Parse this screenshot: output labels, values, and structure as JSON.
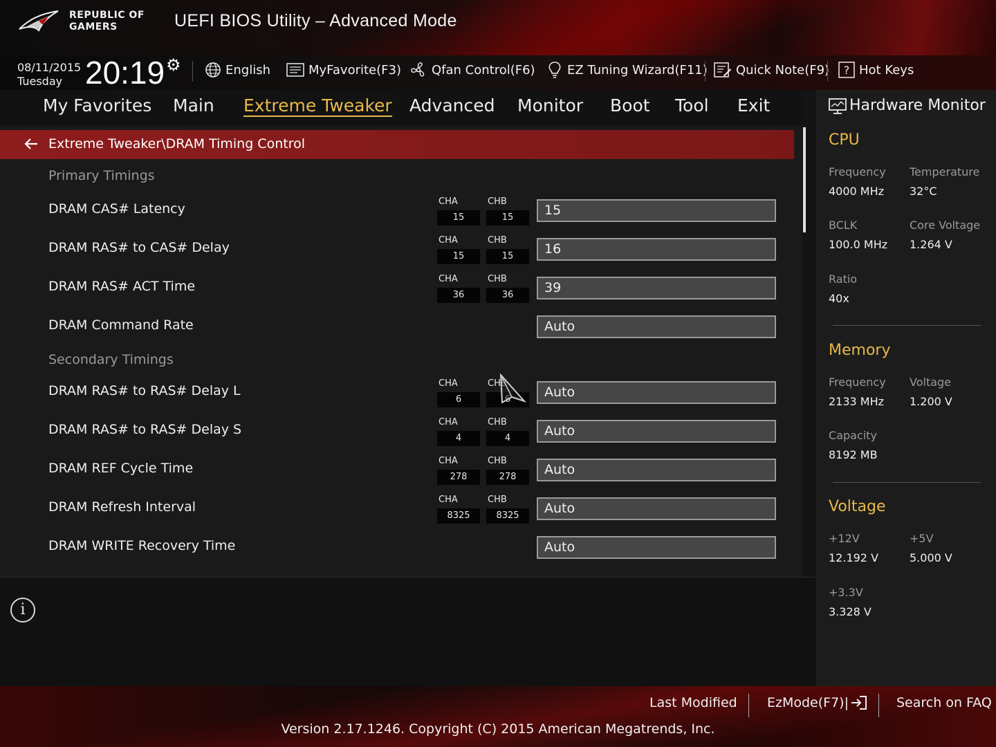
{
  "header": {
    "brand_line1": "REPUBLIC OF",
    "brand_line2": "GAMERS",
    "title": "UEFI BIOS Utility – Advanced Mode"
  },
  "toolbar": {
    "date": "08/11/2015",
    "day": "Tuesday",
    "time": "20:19",
    "items": [
      {
        "label": "English",
        "icon": "globe-icon"
      },
      {
        "label": "MyFavorite(F3)",
        "icon": "favorite-list-icon"
      },
      {
        "label": "Qfan Control(F6)",
        "icon": "fan-icon"
      },
      {
        "label": "EZ Tuning Wizard(F11)",
        "icon": "lightbulb-icon"
      },
      {
        "label": "Quick Note(F9)",
        "icon": "note-icon"
      },
      {
        "label": "Hot Keys",
        "icon": "question-icon"
      }
    ]
  },
  "nav": {
    "tabs": [
      {
        "label": "My Favorites",
        "active": false
      },
      {
        "label": "Main",
        "active": false
      },
      {
        "label": "Extreme Tweaker",
        "active": true
      },
      {
        "label": "Advanced",
        "active": false
      },
      {
        "label": "Monitor",
        "active": false
      },
      {
        "label": "Boot",
        "active": false
      },
      {
        "label": "Tool",
        "active": false
      },
      {
        "label": "Exit",
        "active": false
      }
    ]
  },
  "main": {
    "breadcrumb": "Extreme Tweaker\\DRAM Timing Control",
    "sections": [
      {
        "title": "Primary Timings"
      },
      {
        "title": "Secondary Timings"
      }
    ],
    "rows": [
      {
        "label": "DRAM CAS# Latency",
        "cha_label": "CHA",
        "chb_label": "CHB",
        "cha": "15",
        "chb": "15",
        "value": "15"
      },
      {
        "label": "DRAM RAS# to CAS# Delay",
        "cha_label": "CHA",
        "chb_label": "CHB",
        "cha": "15",
        "chb": "15",
        "value": "16"
      },
      {
        "label": "DRAM RAS# ACT Time",
        "cha_label": "CHA",
        "chb_label": "CHB",
        "cha": "36",
        "chb": "36",
        "value": "39"
      },
      {
        "label": "DRAM Command Rate",
        "value": "Auto"
      },
      {
        "label": "DRAM RAS# to RAS# Delay L",
        "cha_label": "CHA",
        "chb_label": "CHB",
        "cha": "6",
        "chb": "6",
        "value": "Auto"
      },
      {
        "label": "DRAM RAS# to RAS# Delay S",
        "cha_label": "CHA",
        "chb_label": "CHB",
        "cha": "4",
        "chb": "4",
        "value": "Auto"
      },
      {
        "label": "DRAM REF Cycle Time",
        "cha_label": "CHA",
        "chb_label": "CHB",
        "cha": "278",
        "chb": "278",
        "value": "Auto"
      },
      {
        "label": "DRAM Refresh Interval",
        "cha_label": "CHA",
        "chb_label": "CHB",
        "cha": "8325",
        "chb": "8325",
        "value": "Auto"
      },
      {
        "label": "DRAM WRITE Recovery Time",
        "value": "Auto"
      }
    ]
  },
  "hardware_monitor": {
    "title": "Hardware Monitor",
    "cpu": {
      "title": "CPU",
      "frequency_label": "Frequency",
      "frequency": "4000 MHz",
      "temperature_label": "Temperature",
      "temperature": "32°C",
      "bclk_label": "BCLK",
      "bclk": "100.0 MHz",
      "core_voltage_label": "Core Voltage",
      "core_voltage": "1.264 V",
      "ratio_label": "Ratio",
      "ratio": "40x"
    },
    "memory": {
      "title": "Memory",
      "frequency_label": "Frequency",
      "frequency": "2133 MHz",
      "voltage_label": "Voltage",
      "voltage": "1.200 V",
      "capacity_label": "Capacity",
      "capacity": "8192 MB"
    },
    "voltage": {
      "title": "Voltage",
      "v12_label": "+12V",
      "v12": "12.192 V",
      "v5_label": "+5V",
      "v5": "5.000 V",
      "v33_label": "+3.3V",
      "v33": "3.328 V"
    }
  },
  "footer": {
    "last_modified": "Last Modified",
    "ezmode": "EzMode(F7)|",
    "search_faq": "Search on FAQ",
    "version": "Version 2.17.1246. Copyright (C) 2015 American Megatrends, Inc."
  },
  "colors": {
    "accent": "#e8b84a",
    "breadcrumb_bg": "#8e1d1d",
    "field_bg": "#464646",
    "brand_red": "#b01010"
  }
}
